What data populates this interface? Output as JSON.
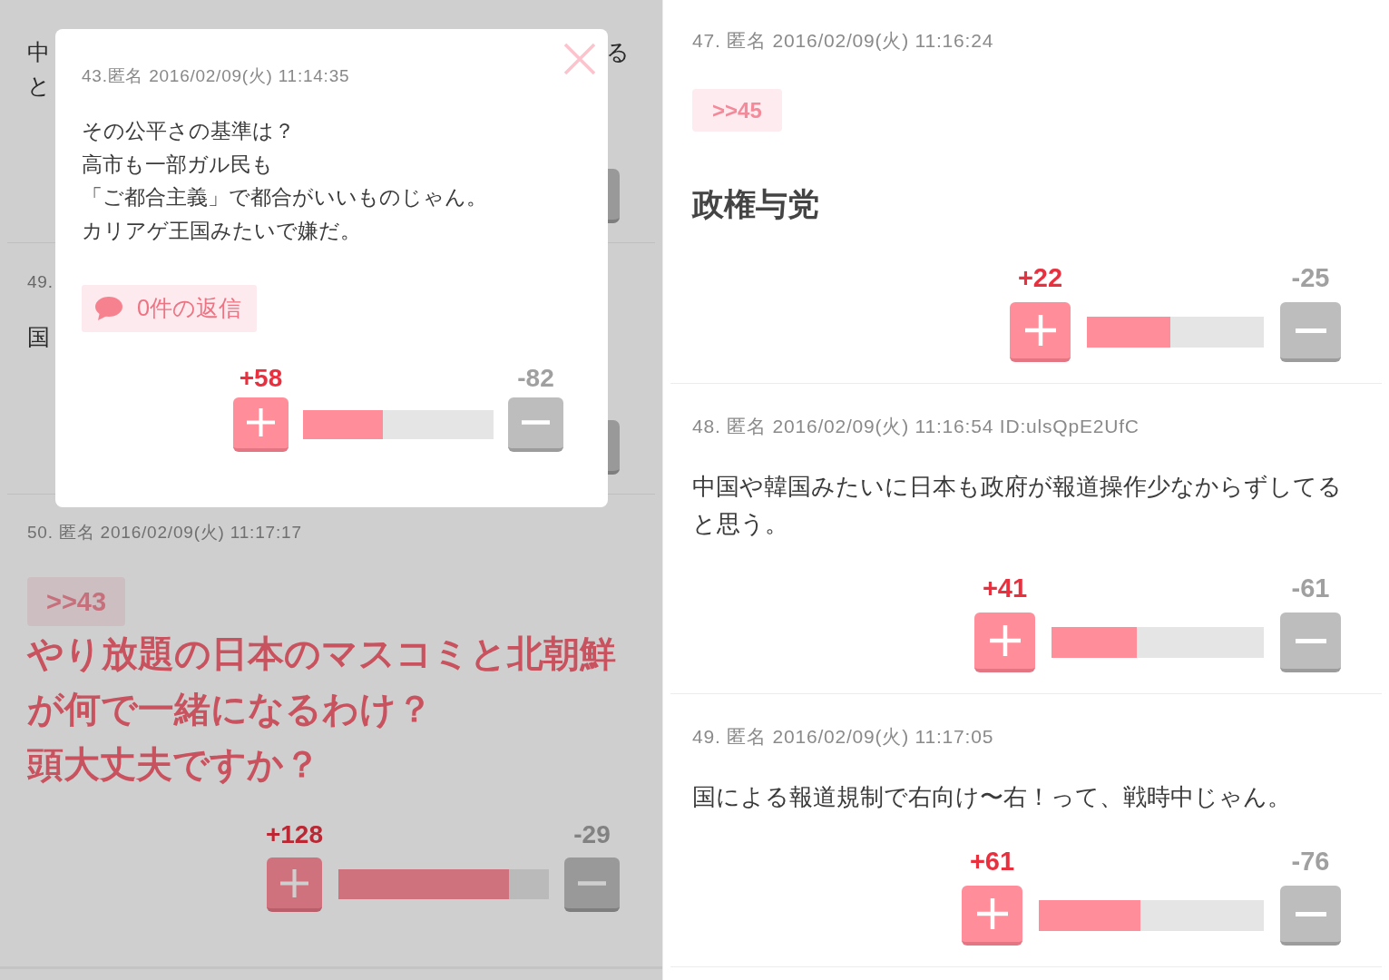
{
  "left_screen": {
    "posts": [
      {
        "kind": "covered",
        "large": false,
        "highlighted": false,
        "lines": [
          {
            "left": "中",
            "right": "る"
          },
          {
            "left": "と"
          }
        ]
      },
      {
        "kind": "covered",
        "large": false,
        "highlighted": false,
        "number": "49.",
        "lines": [
          {
            "left": "国"
          }
        ]
      },
      {
        "kind": "full",
        "header": "50. 匿名 2016/02/09(火) 11:17:17",
        "quote": ">>43",
        "large": true,
        "highlighted": true,
        "body": [
          "やり放題の日本のマスコミと北朝鮮が何で一緒になるわけ？",
          "頭大丈夫ですか？"
        ],
        "votes": {
          "plus": "+128",
          "minus": "-29",
          "level": 0.81
        }
      }
    ],
    "popup": {
      "header": "43.匿名 2016/02/09(火) 11:14:35",
      "body": [
        "その公平さの基準は？",
        "高市も一部ガル民も",
        "「ご都合主義」で都合がいいものじゃん。",
        "カリアゲ王国みたいで嫌だ。"
      ],
      "reply_button": "0件の返信",
      "votes": {
        "plus": "+58",
        "minus": "-82",
        "level": 0.42
      }
    }
  },
  "right_screen": {
    "posts": [
      {
        "header": "47. 匿名 2016/02/09(火) 11:16:24",
        "quote": ">>45",
        "large": true,
        "highlighted": false,
        "body": [
          "政権与党"
        ],
        "votes": {
          "plus": "+22",
          "minus": "-25",
          "level": 0.47
        }
      },
      {
        "header": "48. 匿名 2016/02/09(火) 11:16:54 ID:ulsQpE2UfC",
        "large": false,
        "highlighted": false,
        "body": [
          "中国や韓国みたいに日本も政府が報道操作少なからずしてると思う。"
        ],
        "votes": {
          "plus": "+41",
          "minus": "-61",
          "level": 0.4
        }
      },
      {
        "header": "49. 匿名 2016/02/09(火) 11:17:05",
        "large": false,
        "highlighted": false,
        "body": [
          "国による報道規制で右向け〜右！って、戦時中じゃん。"
        ],
        "votes": {
          "plus": "+61",
          "minus": "-76",
          "level": 0.45
        }
      }
    ]
  }
}
